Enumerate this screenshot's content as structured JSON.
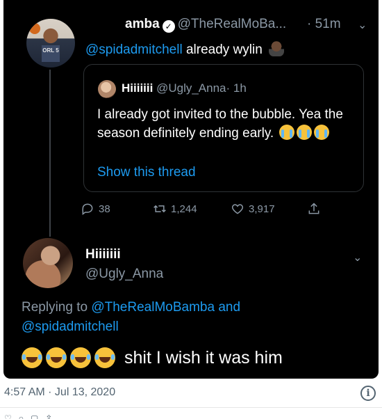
{
  "original_tweet": {
    "display_name": "amba",
    "handle": "@TheRealMoBa...",
    "time": "· 51m",
    "reply_to": "@spidadmitchell",
    "text": "already wylin",
    "avatar_jersey": "ORL 5"
  },
  "quoted_tweet": {
    "display_name": "Hiiiiiii",
    "handle": "@Ugly_Anna",
    "time": "· 1h",
    "text": "I already got invited to the bubble. Yea the season definitely ending early.",
    "show_thread": "Show this thread"
  },
  "actions": {
    "replies": "38",
    "retweets": "1,244",
    "likes": "3,917"
  },
  "reply_tweet": {
    "display_name": "Hiiiiiii",
    "handle": "@Ugly_Anna",
    "replying_prefix": "Replying to",
    "replying_to_1": "@TheRealMoBamba",
    "replying_and": "and",
    "replying_to_2": "@spidadmitchell",
    "text": "shit I wish it was him"
  },
  "footer": {
    "timestamp": "4:57 AM · Jul 13, 2020"
  },
  "colors": {
    "background": "#000000",
    "link": "#1d9bf0",
    "muted": "#8b98a5"
  }
}
